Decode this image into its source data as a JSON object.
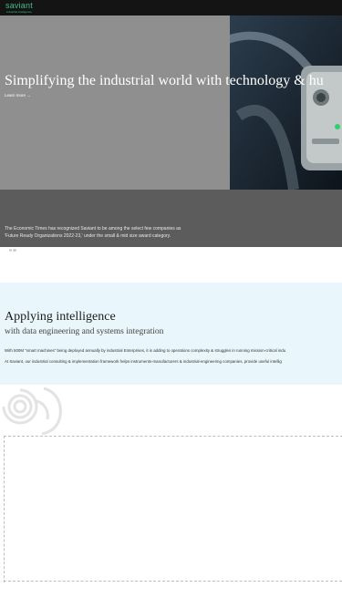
{
  "brand": {
    "logo_word": "saviant",
    "logo_tagline": "industrial intelligence",
    "accent_color": "#3dbf8a"
  },
  "hero": {
    "title": "Simplifying the industrial world with technology & hu",
    "link_label": "Learn more →"
  },
  "recognition": {
    "line1": "The Economic Times has recognized Saviant to be among the select few companies as",
    "line2": "'Future Ready Organizations 2022-23,' under the small & mid size award category.",
    "slide_count": 3,
    "active_slide": 1
  },
  "intelligence": {
    "title": "Applying intelligence",
    "subtitle": "with data engineering and systems integration",
    "paragraph1": "With 500M \"smart machines\" being deployed annually by industrial Enterprises, it is adding to operations complexity & struggles in running mission-critical indu",
    "paragraph2": "At Saviant, our industrial consulting & implementation framework helps instruments-manufacturers & industrial-engineering companies, provide useful intellig"
  },
  "icons": {
    "logo": "saviant-logo-icon",
    "swirl": "swirl-decoration-icon",
    "arrow": "arrow-right-icon"
  }
}
